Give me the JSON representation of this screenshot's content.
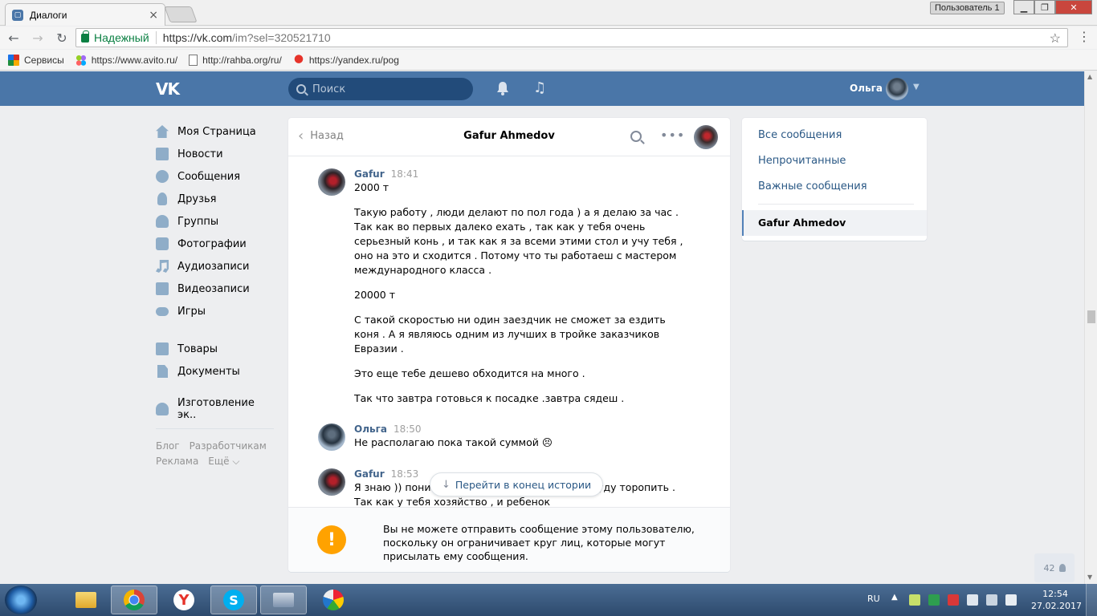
{
  "browser": {
    "tab_title": "Диалоги",
    "profile_badge": "Пользователь 1",
    "secure_label": "Надежный",
    "url_host": "https://vk.com",
    "url_path": "/im?sel=320521710",
    "bookmarks": [
      {
        "label": "Сервисы",
        "icon": "apps-icon"
      },
      {
        "label": "https://www.avito.ru/",
        "icon": "avito-icon"
      },
      {
        "label": "http://rahba.org/ru/",
        "icon": "page-icon"
      },
      {
        "label": "https://yandex.ru/pog",
        "icon": "yandex-icon"
      }
    ]
  },
  "vk_header": {
    "logo": "VK",
    "search_placeholder": "Поиск",
    "user_name": "Ольга"
  },
  "left_nav": {
    "items": [
      {
        "label": "Моя Страница",
        "icon": "home-icon"
      },
      {
        "label": "Новости",
        "icon": "news-icon"
      },
      {
        "label": "Сообщения",
        "icon": "messages-icon"
      },
      {
        "label": "Друзья",
        "icon": "friends-icon"
      },
      {
        "label": "Группы",
        "icon": "groups-icon"
      },
      {
        "label": "Фотографии",
        "icon": "photo-icon"
      },
      {
        "label": "Аудиозаписи",
        "icon": "audio-icon"
      },
      {
        "label": "Видеозаписи",
        "icon": "video-icon"
      },
      {
        "label": "Игры",
        "icon": "games-icon"
      }
    ],
    "items2": [
      {
        "label": "Товары",
        "icon": "goods-icon"
      },
      {
        "label": "Документы",
        "icon": "docs-icon"
      }
    ],
    "items3": [
      {
        "label": "Изготовление эк..",
        "icon": "groups-icon"
      }
    ],
    "footer": {
      "blog": "Блог",
      "developers": "Разработчикам",
      "ads": "Реклама",
      "more": "Ещё ⌵"
    }
  },
  "dialog": {
    "back_label": "Назад",
    "title": "Gafur Ahmedov",
    "messages": [
      {
        "author": "Gafur",
        "time": "18:41",
        "paragraphs": [
          "2000 т",
          "Такую работу , люди делают по пол года ) а я делаю за час . Так как во первых далеко ехать , так как у тебя очень серьезный конь , и так как я за всеми этими стол и учу тебя , оно на это и сходится . Потому что ты работаеш с мастером международного класса .",
          "20000 т",
          "С такой скоростью ни один заездчик не сможет за ездить коня . А я являюсь одним из лучших в тройке заказчиков Евразии .",
          "Это еще тебе дешево обходится на много .",
          "Так что завтра готовься к посадке .завтра сядеш ."
        ]
      },
      {
        "author": "Ольга",
        "time": "18:50",
        "paragraphs": [
          "Не располагаю пока такой суммой 😣"
        ]
      },
      {
        "author": "Gafur",
        "time": "18:53",
        "paragraphs": [
          "Я знаю )) поним... ...дать в карту . Я тебя не буду торопить . Так как у тебя хозяйство , и ребенок"
        ]
      }
    ],
    "jump_label": "Перейти в конец истории",
    "blocked_notice": "Вы не можете отправить сообщение этому пользователю, поскольку он ограничивает круг лиц, которые могут присылать ему сообщения."
  },
  "right_panel": {
    "all": "Все сообщения",
    "unread": "Непрочитанные",
    "important": "Важные сообщения",
    "active_chat": "Gafur Ahmedov"
  },
  "online_count": "42",
  "taskbar": {
    "lang": "RU",
    "time": "12:54",
    "date": "27.02.2017"
  },
  "colors": {
    "vk_blue": "#4a76a8",
    "link": "#2a5885",
    "warning": "#ffa200"
  }
}
